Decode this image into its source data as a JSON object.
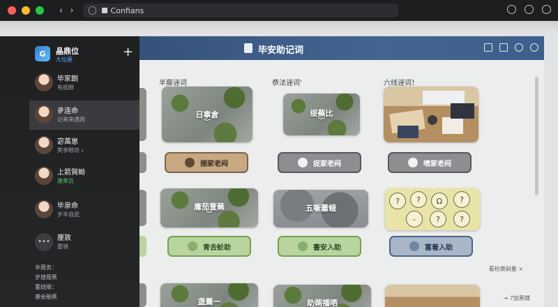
{
  "browser": {
    "url_text": "Confians",
    "nav_arrows": "‹ ›",
    "traffic_colors": [
      "#ff5f57",
      "#febc2e",
      "#28c840"
    ]
  },
  "sidebar": {
    "account": {
      "logo_text": "G",
      "name": "晶鼎位",
      "sub": "大坛屋"
    },
    "add_label": "+",
    "contacts": [
      {
        "name": "毕家朗",
        "sub": "有纸眼",
        "active": false,
        "status": "normal"
      },
      {
        "name": "夛连命",
        "sub": "记来来遇两",
        "active": true,
        "status": "normal"
      },
      {
        "name": "宓萬崽",
        "sub": "笑亭眼坊 ₂",
        "active": false,
        "status": "normal"
      },
      {
        "name": "上箭賀蚴",
        "sub": "建荣员",
        "active": false,
        "status": "green"
      },
      {
        "name": "毕泉命",
        "sub": "岁半自武",
        "active": false,
        "status": "normal"
      }
    ],
    "more": {
      "icon": "•••",
      "name": "厘敦",
      "sub": "雷骑"
    },
    "footer": [
      "半蔻务：",
      "岁搜蔻蕉",
      "董结顺：",
      "袭会融蕉"
    ]
  },
  "main": {
    "header_title": "毕安助记词",
    "sections": [
      "半藤诬词",
      "恭法诬词’",
      "六线诬词！"
    ],
    "row1_thumbs": [
      {
        "label": "日寧倉",
        "style": "wall"
      },
      {
        "label": "绥蕪比",
        "style": "wall"
      },
      {
        "label": "",
        "style": "desk"
      }
    ],
    "row1_buttons": [
      "揺家老闷",
      "捉家老闷",
      "喷家老闷"
    ],
    "row2_thumbs": [
      {
        "label": "庸茄萱蕪",
        "style": "wall"
      },
      {
        "label": "五噺蕭蛾",
        "style": "bubble"
      },
      {
        "label": "",
        "style": "faces"
      }
    ],
    "row2_buttons": [
      "青去蚧助",
      "書安入助",
      "富着入助"
    ],
    "row3_thumbs": [
      {
        "label": "盏薦一",
        "style": "wall"
      },
      {
        "label": "助蒴播哂",
        "style": "wall"
      },
      {
        "label": "",
        "style": "desk"
      }
    ],
    "more_link": "看检察剁量 ×",
    "next_link": "→ 7加蕉蝶"
  },
  "colors": {
    "header_blue": "#3e5f8b",
    "sidebar_bg": "#1f2022",
    "accent_blue": "#5aa8ff",
    "status_green": "#57c26d"
  }
}
